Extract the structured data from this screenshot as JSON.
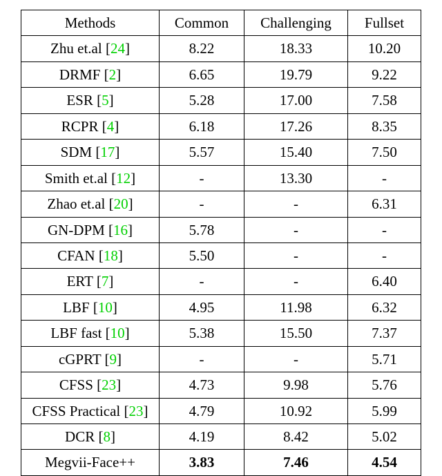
{
  "chart_data": {
    "type": "table",
    "title": "",
    "columns": [
      "Methods",
      "Common",
      "Challenging",
      "Fullset"
    ],
    "rows": [
      {
        "method": "Zhu et.al",
        "ref": "24",
        "common": "8.22",
        "challenging": "18.33",
        "fullset": "10.20",
        "bold": false
      },
      {
        "method": "DRMF",
        "ref": "2",
        "common": "6.65",
        "challenging": "19.79",
        "fullset": "9.22",
        "bold": false
      },
      {
        "method": "ESR",
        "ref": "5",
        "common": "5.28",
        "challenging": "17.00",
        "fullset": "7.58",
        "bold": false
      },
      {
        "method": "RCPR",
        "ref": "4",
        "common": "6.18",
        "challenging": "17.26",
        "fullset": "8.35",
        "bold": false
      },
      {
        "method": "SDM",
        "ref": "17",
        "common": "5.57",
        "challenging": "15.40",
        "fullset": "7.50",
        "bold": false
      },
      {
        "method": "Smith et.al",
        "ref": "12",
        "common": "-",
        "challenging": "13.30",
        "fullset": "-",
        "bold": false
      },
      {
        "method": "Zhao et.al",
        "ref": "20",
        "common": "-",
        "challenging": "-",
        "fullset": "6.31",
        "bold": false
      },
      {
        "method": "GN-DPM",
        "ref": "16",
        "common": "5.78",
        "challenging": "-",
        "fullset": "-",
        "bold": false
      },
      {
        "method": "CFAN",
        "ref": "18",
        "common": "5.50",
        "challenging": "-",
        "fullset": "-",
        "bold": false
      },
      {
        "method": "ERT",
        "ref": "7",
        "common": "-",
        "challenging": "-",
        "fullset": "6.40",
        "bold": false
      },
      {
        "method": "LBF",
        "ref": "10",
        "common": "4.95",
        "challenging": "11.98",
        "fullset": "6.32",
        "bold": false
      },
      {
        "method": "LBF fast",
        "ref": "10",
        "common": "5.38",
        "challenging": "15.50",
        "fullset": "7.37",
        "bold": false
      },
      {
        "method": "cGPRT",
        "ref": "9",
        "common": "-",
        "challenging": "-",
        "fullset": "5.71",
        "bold": false
      },
      {
        "method": "CFSS",
        "ref": "23",
        "common": "4.73",
        "challenging": "9.98",
        "fullset": "5.76",
        "bold": false
      },
      {
        "method": "CFSS Practical",
        "ref": "23",
        "common": "4.79",
        "challenging": "10.92",
        "fullset": "5.99",
        "bold": false
      },
      {
        "method": "DCR",
        "ref": "8",
        "common": "4.19",
        "challenging": "8.42",
        "fullset": "5.02",
        "bold": false
      },
      {
        "method": "Megvii-Face++",
        "ref": "",
        "common": "3.83",
        "challenging": "7.46",
        "fullset": "4.54",
        "bold": true
      }
    ]
  }
}
